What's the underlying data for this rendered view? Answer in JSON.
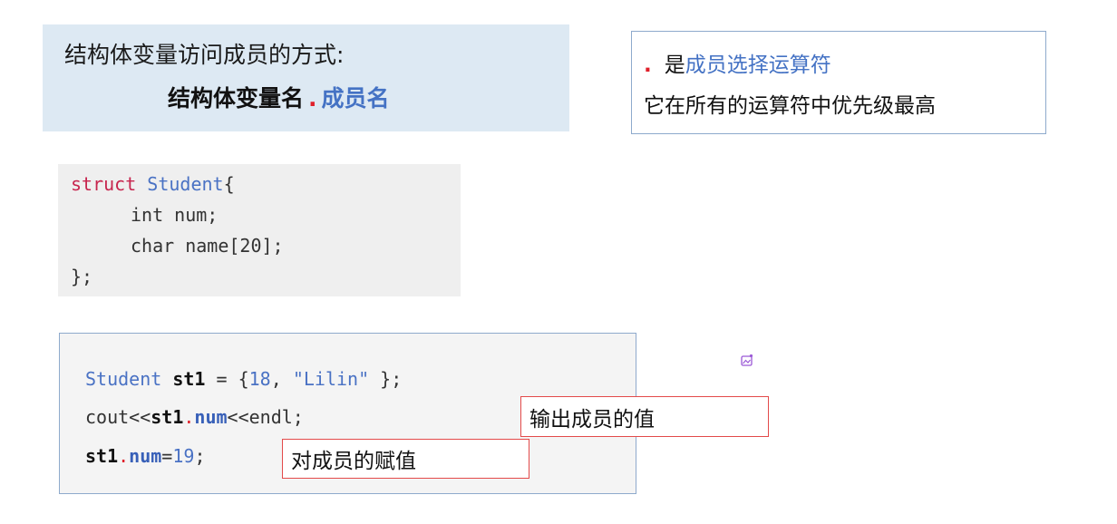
{
  "access_box": {
    "heading": "结构体变量访问成员的方式:",
    "struct_var": "结构体变量名",
    "dot": ".",
    "member": "成员名"
  },
  "operator_box": {
    "dot": ".",
    "is": "是",
    "desc": "成员选择运算符",
    "priority": "它在所有的运算符中优先级最高"
  },
  "struct_code": {
    "kw_struct": "struct",
    "type_name": "Student",
    "open": "{",
    "field1": "int num;",
    "field2": "char name[20];",
    "close": "};"
  },
  "usage_code": {
    "l1_type": "Student",
    "l1_var": "st1",
    "l1_eq": " = {",
    "l1_num": "18",
    "l1_comma": ", ",
    "l1_str": "\"Lilin\"",
    "l1_end": " };",
    "l2_pre": "cout<<",
    "l2_var": "st1",
    "l2_dot": ".",
    "l2_mem": "num",
    "l2_post": "<<endl;",
    "l3_var": "st1",
    "l3_dot": ".",
    "l3_mem": "num",
    "l3_eq": "=",
    "l3_num": "19",
    "l3_end": ";"
  },
  "notes": {
    "output_value": "输出成员的值",
    "assign_value": "对成员的赋值"
  },
  "colors": {
    "accent_blue": "#4472c4",
    "dot_red": "#e0202a",
    "panel_bg": "#dde9f3",
    "note_border": "#e34a4a"
  },
  "icons": {
    "corner": "image-edit-icon"
  }
}
